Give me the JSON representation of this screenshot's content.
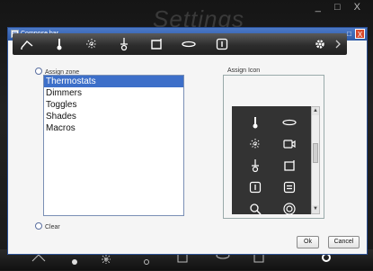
{
  "background": {
    "title": "Settings",
    "window_controls": "_ □ X"
  },
  "dialog": {
    "title": "Compose bar",
    "controls": {
      "minimize": "_",
      "maximize": "□",
      "close": "X"
    }
  },
  "toolbar": {
    "icons": [
      "home-icon",
      "thermometer-icon",
      "light-icon",
      "dimmer-icon",
      "shade-icon",
      "oval-icon",
      "toggle-icon",
      "settings-icon",
      "chevron-right-icon"
    ]
  },
  "zone": {
    "label": "Assign zone",
    "items": [
      "Thermostats",
      "Dimmers",
      "Toggles",
      "Shades",
      "Macros"
    ],
    "selected": "Thermostats"
  },
  "icons_panel": {
    "label": "Assign Icon",
    "grid": [
      "thermometer-icon",
      "oval-icon",
      "light-icon",
      "camera-icon",
      "dimmer-icon",
      "shade-icon",
      "toggle-icon",
      "list-icon",
      "search-icon",
      "target-icon"
    ]
  },
  "clear_label": "Clear",
  "buttons": {
    "ok": "Ok",
    "cancel": "Cancel"
  },
  "colors": {
    "accent": "#3d6fc9",
    "titlebar": "#2e5aa6",
    "close": "#d9492c"
  }
}
